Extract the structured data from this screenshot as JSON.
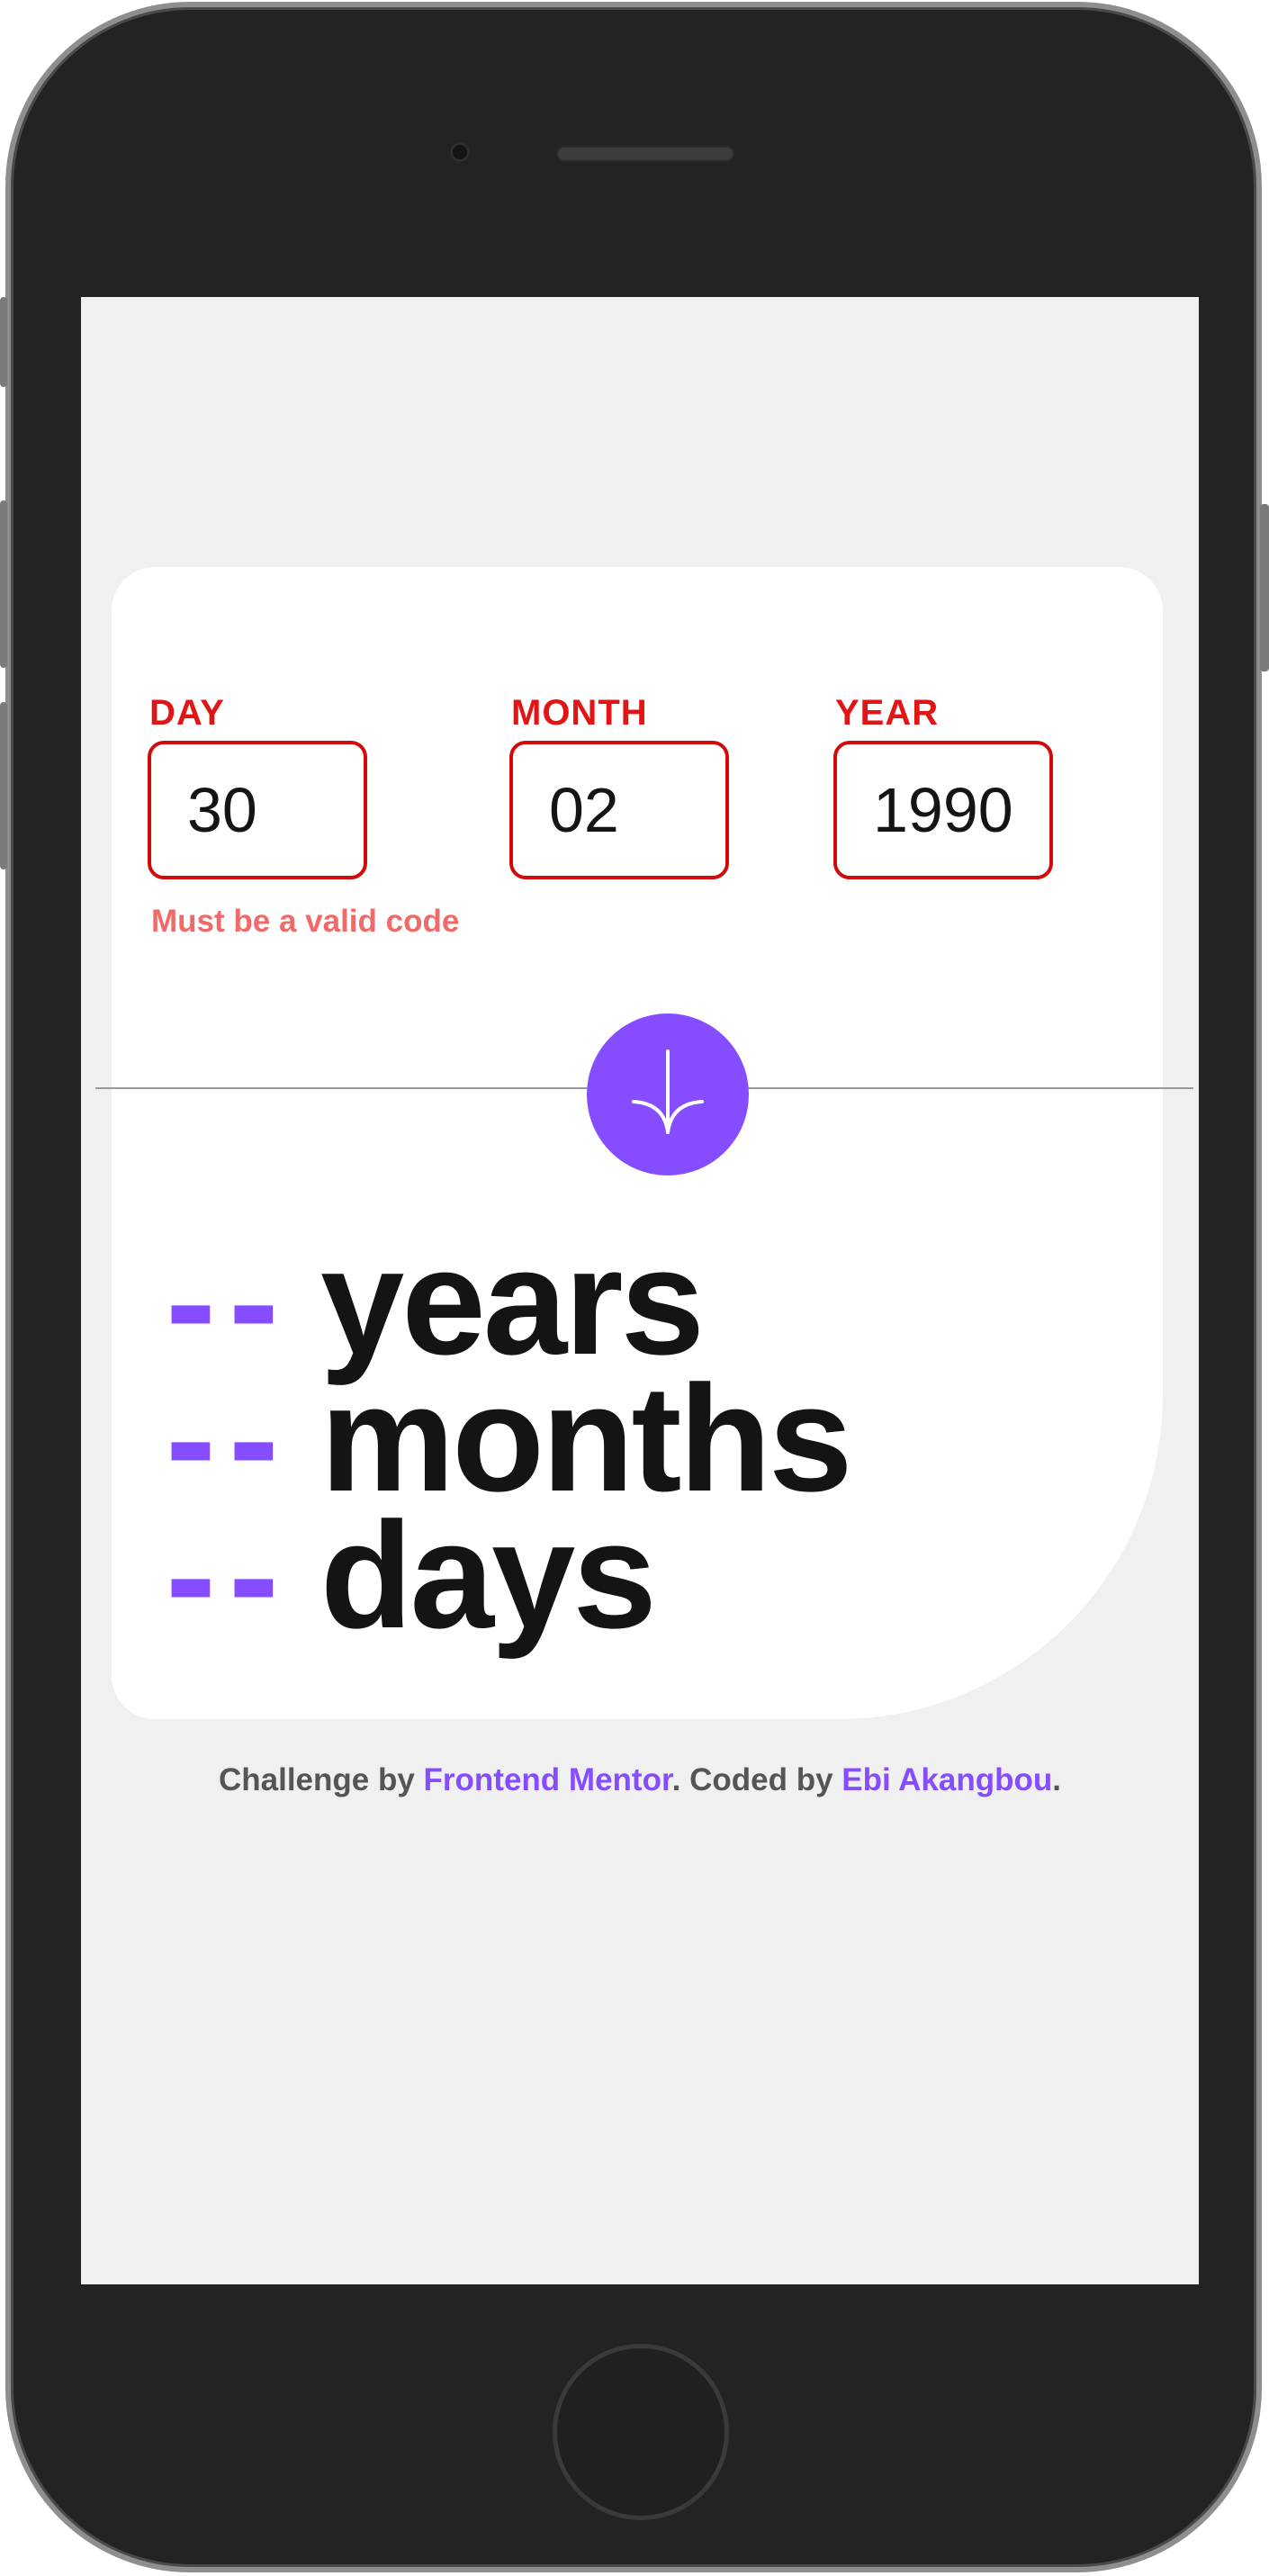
{
  "form": {
    "day": {
      "label": "DAY",
      "value": "30"
    },
    "month": {
      "label": "MONTH",
      "value": "02"
    },
    "year": {
      "label": "YEAR",
      "value": "1990"
    },
    "error": "Must be a valid code"
  },
  "submit": {
    "icon": "arrow-down-icon",
    "color": "#854dff"
  },
  "results": {
    "years": {
      "value": "--",
      "unit": "years"
    },
    "months": {
      "value": "--",
      "unit": "months"
    },
    "days": {
      "value": "--",
      "unit": "days"
    }
  },
  "footer": {
    "prefix": "Challenge by",
    "link1": "Frontend Mentor",
    "middle": ". Coded by",
    "link2": "Ebi Akangbou",
    "suffix": "."
  },
  "colors": {
    "accent": "#854dff",
    "error": "#e01515",
    "text": "#141414"
  }
}
